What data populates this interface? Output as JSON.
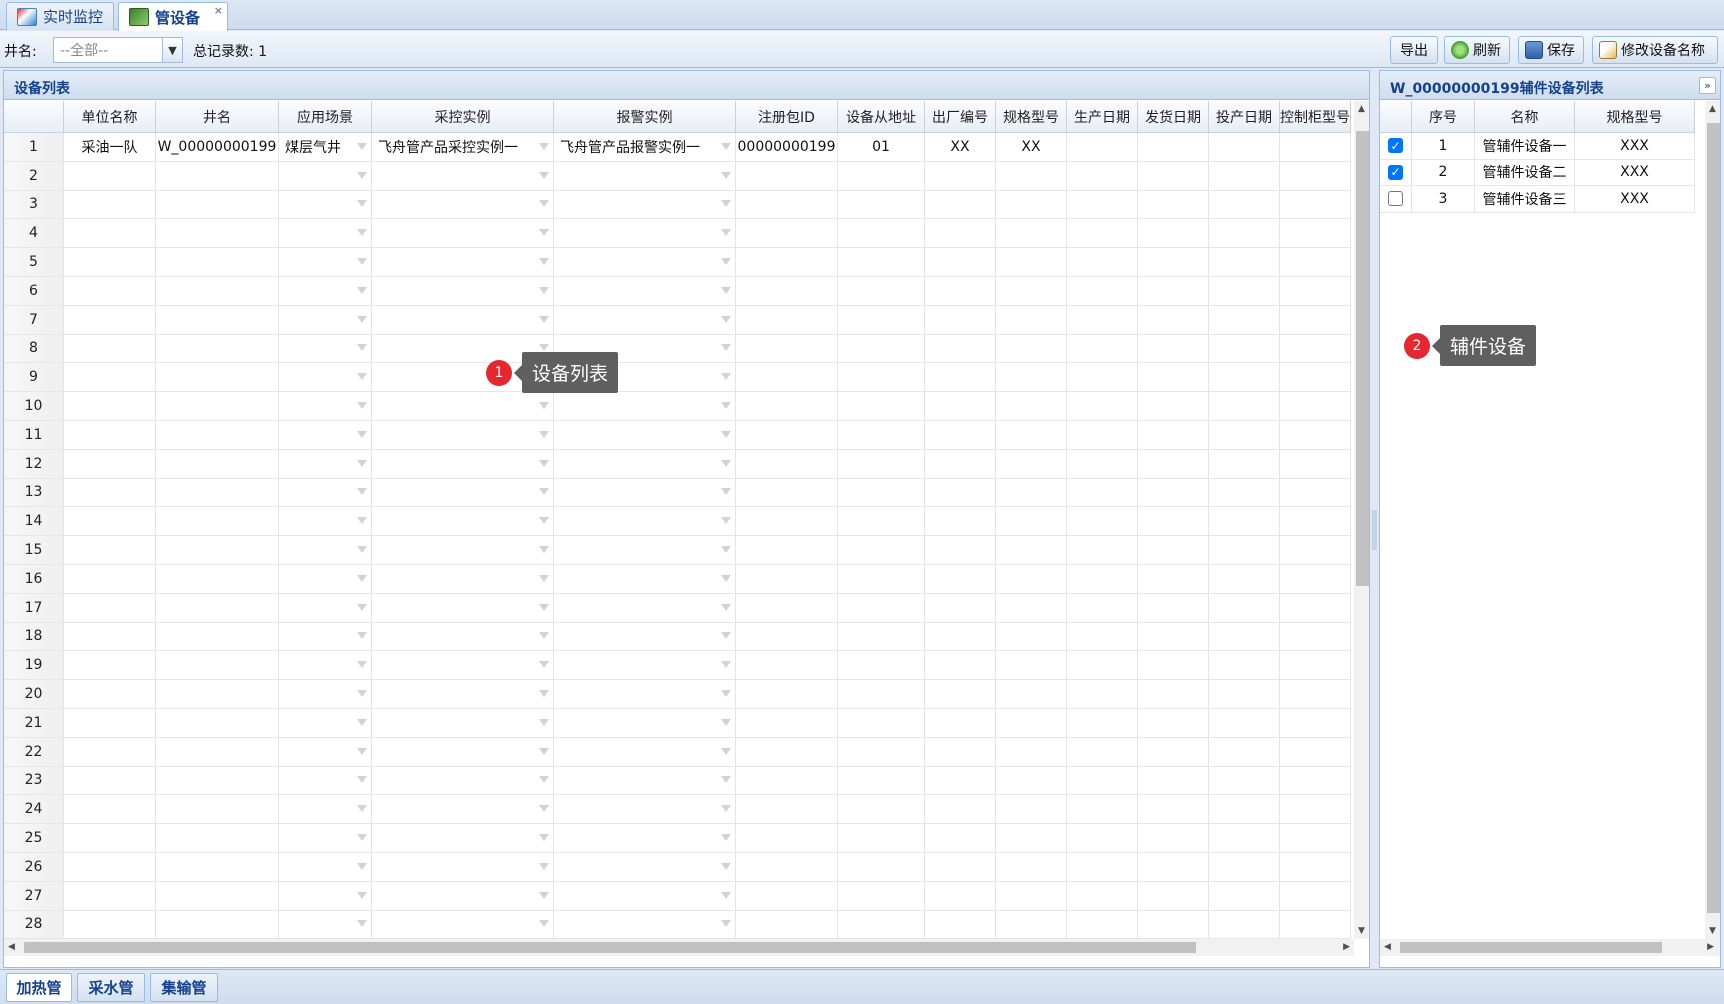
{
  "tabs": [
    {
      "label": "实时监控",
      "icon": "monitor-icon"
    },
    {
      "label": "管设备",
      "icon": "device-icon",
      "close": "×"
    }
  ],
  "toolbar": {
    "well_label": "井名:",
    "well_value": "--全部--",
    "total_label": "总记录数: 1",
    "export_label": "导出",
    "refresh_label": "刷新",
    "save_label": "保存",
    "rename_label": "修改设备名称"
  },
  "device_panel": {
    "title": "设备列表",
    "columns": [
      "",
      "单位名称",
      "井名",
      "应用场景",
      "采控实例",
      "报警实例",
      "注册包ID",
      "设备从地址",
      "出厂编号",
      "规格型号",
      "生产日期",
      "发货日期",
      "投产日期",
      "控制柜型号"
    ],
    "rows": [
      {
        "n": "1",
        "unit": "采油一队",
        "well": "W_00000000199",
        "scene": "煤层气井",
        "ctrl": "飞舟管产品采控实例一",
        "alarm": "飞舟管产品报警实例一",
        "reg": "00000000199",
        "addr": "01",
        "serial": "XX",
        "model": "XX",
        "prod": "",
        "ship": "",
        "commission": "",
        "cabinet": ""
      },
      {
        "n": "2"
      },
      {
        "n": "3"
      },
      {
        "n": "4"
      },
      {
        "n": "5"
      },
      {
        "n": "6"
      },
      {
        "n": "7"
      },
      {
        "n": "8"
      },
      {
        "n": "9"
      },
      {
        "n": "10"
      },
      {
        "n": "11"
      },
      {
        "n": "12"
      },
      {
        "n": "13"
      },
      {
        "n": "14"
      },
      {
        "n": "15"
      },
      {
        "n": "16"
      },
      {
        "n": "17"
      },
      {
        "n": "18"
      },
      {
        "n": "19"
      },
      {
        "n": "20"
      },
      {
        "n": "21"
      },
      {
        "n": "22"
      },
      {
        "n": "23"
      },
      {
        "n": "24"
      },
      {
        "n": "25"
      },
      {
        "n": "26"
      },
      {
        "n": "27"
      },
      {
        "n": "28"
      }
    ]
  },
  "aux_panel": {
    "title": "W_00000000199辅件设备列表",
    "columns": [
      "",
      "序号",
      "名称",
      "规格型号"
    ],
    "rows": [
      {
        "checked": true,
        "seq": "1",
        "name": "管辅件设备一",
        "model": "XXX"
      },
      {
        "checked": true,
        "seq": "2",
        "name": "管辅件设备二",
        "model": "XXX"
      },
      {
        "checked": false,
        "seq": "3",
        "name": "管辅件设备三",
        "model": "XXX"
      }
    ]
  },
  "callouts": [
    {
      "num": "1",
      "text": "设备列表"
    },
    {
      "num": "2",
      "text": "辅件设备"
    }
  ],
  "bottom_tabs": [
    "加热管",
    "采水管",
    "集输管"
  ],
  "colors": {
    "accent": "#15428b",
    "border": "#99bbe8",
    "badge": "#e8262f",
    "checkbox": "#0075ff"
  }
}
